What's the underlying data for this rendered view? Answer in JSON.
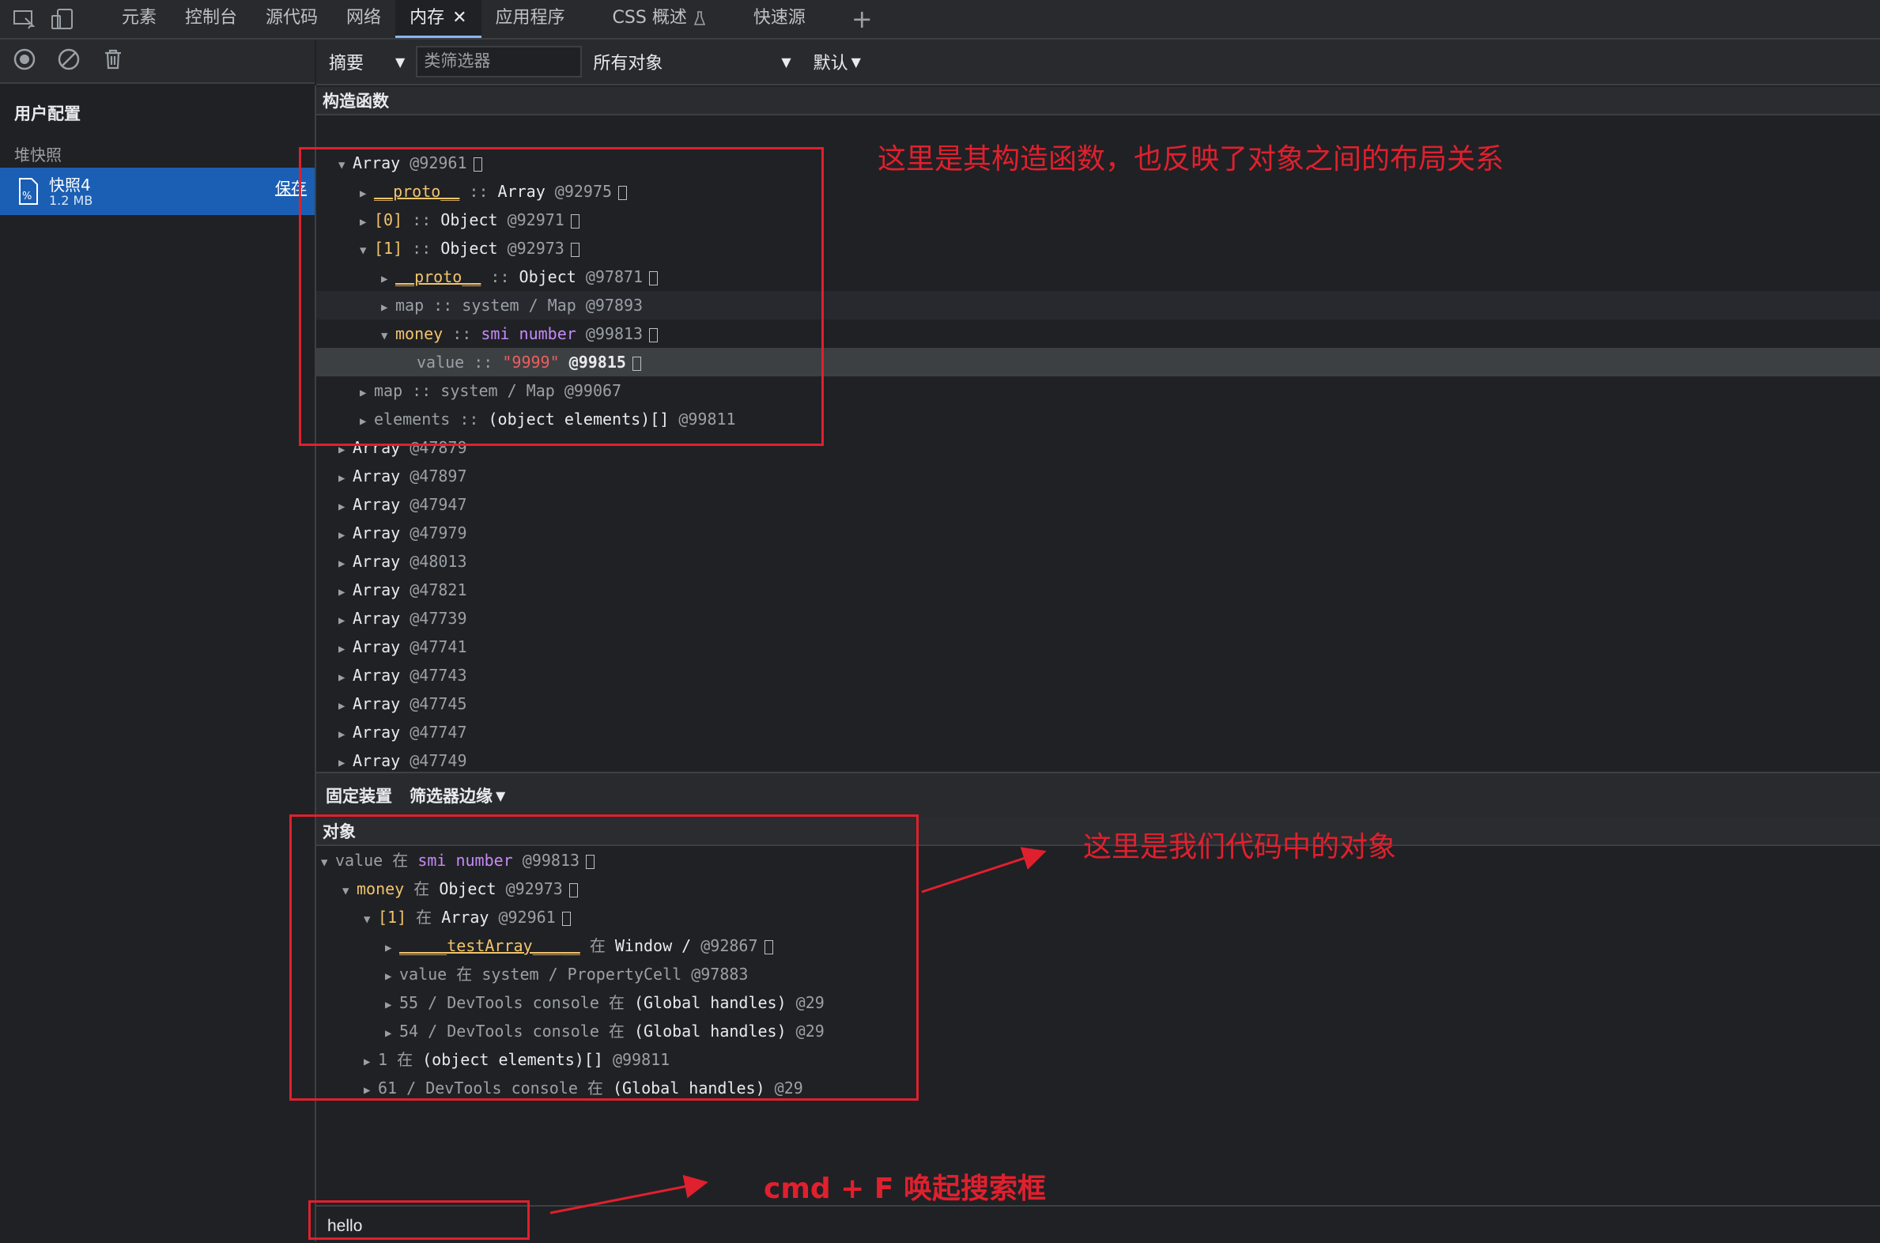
{
  "tabs": {
    "items": [
      "元素",
      "控制台",
      "源代码",
      "网络",
      "内存",
      "应用程序",
      "CSS 概述",
      "快速源"
    ],
    "active_index": 4,
    "close_glyph": "✕",
    "add_glyph": "+"
  },
  "sidebar": {
    "profiles_title": "用户配置",
    "heap_title": "堆快照",
    "snapshot_name": "快照4",
    "snapshot_size": "1.2 MB",
    "save_label": "保存"
  },
  "toolbar": {
    "view_select": "摘要",
    "class_filter_placeholder": "类筛选器",
    "objects_select": "所有对象",
    "default_select": "默认"
  },
  "constructor_header": "构造函数",
  "retainers_bar": {
    "fixtures_label": "固定装置",
    "filter_edges_label": "筛选器边缘"
  },
  "object_header": "对象",
  "constructor_tree": [
    {
      "indent": 0,
      "arrow": "down",
      "parts": [
        {
          "t": "Array",
          "c": "k"
        },
        {
          "t": " @92961",
          "c": "dim"
        }
      ],
      "box": true
    },
    {
      "indent": 1,
      "arrow": "right",
      "parts": [
        {
          "t": "__proto__",
          "c": "kp u"
        },
        {
          "t": " :: ",
          "c": "sep"
        },
        {
          "t": "Array",
          "c": "k"
        },
        {
          "t": " @92975",
          "c": "dim"
        }
      ],
      "box": true
    },
    {
      "indent": 1,
      "arrow": "right",
      "parts": [
        {
          "t": "[0]",
          "c": "kp"
        },
        {
          "t": " :: ",
          "c": "sep"
        },
        {
          "t": "Object",
          "c": "k"
        },
        {
          "t": " @92971",
          "c": "dim"
        }
      ],
      "box": true
    },
    {
      "indent": 1,
      "arrow": "down",
      "parts": [
        {
          "t": "[1]",
          "c": "kp"
        },
        {
          "t": " :: ",
          "c": "sep"
        },
        {
          "t": "Object",
          "c": "k"
        },
        {
          "t": " @92973",
          "c": "dim"
        }
      ],
      "box": true
    },
    {
      "indent": 2,
      "arrow": "right",
      "parts": [
        {
          "t": "__proto__",
          "c": "kp u"
        },
        {
          "t": " :: ",
          "c": "sep"
        },
        {
          "t": "Object",
          "c": "k"
        },
        {
          "t": " @97871",
          "c": "dim"
        }
      ],
      "box": true
    },
    {
      "indent": 2,
      "arrow": "right",
      "hl": "hl2",
      "parts": [
        {
          "t": "map",
          "c": "dim"
        },
        {
          "t": " :: ",
          "c": "sep"
        },
        {
          "t": "system / Map",
          "c": "dim"
        },
        {
          "t": " @97893",
          "c": "dim"
        }
      ],
      "box": false
    },
    {
      "indent": 2,
      "arrow": "down",
      "parts": [
        {
          "t": "money",
          "c": "kp"
        },
        {
          "t": " :: ",
          "c": "sep"
        },
        {
          "t": "smi number",
          "c": "kpurple"
        },
        {
          "t": " @99813",
          "c": "dim"
        }
      ],
      "box": true
    },
    {
      "indent": 3,
      "arrow": "none",
      "hl": "hl",
      "parts": [
        {
          "t": "value",
          "c": "dim"
        },
        {
          "t": " :: ",
          "c": "sep"
        },
        {
          "t": "\"9999\"",
          "c": "str"
        },
        {
          "t": " @99815",
          "c": "kb"
        }
      ],
      "box": true
    },
    {
      "indent": 1,
      "arrow": "right",
      "parts": [
        {
          "t": "map",
          "c": "dim"
        },
        {
          "t": " :: ",
          "c": "sep"
        },
        {
          "t": "system / Map",
          "c": "dim"
        },
        {
          "t": " @99067",
          "c": "dim"
        }
      ],
      "box": false
    },
    {
      "indent": 1,
      "arrow": "right",
      "parts": [
        {
          "t": "elements",
          "c": "dim"
        },
        {
          "t": " :: ",
          "c": "sep"
        },
        {
          "t": "(object elements)[]",
          "c": "k"
        },
        {
          "t": " @99811",
          "c": "dim"
        }
      ],
      "box": false
    },
    {
      "indent": 0,
      "arrow": "right",
      "parts": [
        {
          "t": "Array",
          "c": "k"
        },
        {
          "t": " @47879",
          "c": "dim"
        }
      ],
      "box": false
    },
    {
      "indent": 0,
      "arrow": "right",
      "parts": [
        {
          "t": "Array",
          "c": "k"
        },
        {
          "t": " @47897",
          "c": "dim"
        }
      ],
      "box": false
    },
    {
      "indent": 0,
      "arrow": "right",
      "parts": [
        {
          "t": "Array",
          "c": "k"
        },
        {
          "t": " @47947",
          "c": "dim"
        }
      ],
      "box": false
    },
    {
      "indent": 0,
      "arrow": "right",
      "parts": [
        {
          "t": "Array",
          "c": "k"
        },
        {
          "t": " @47979",
          "c": "dim"
        }
      ],
      "box": false
    },
    {
      "indent": 0,
      "arrow": "right",
      "parts": [
        {
          "t": "Array",
          "c": "k"
        },
        {
          "t": " @48013",
          "c": "dim"
        }
      ],
      "box": false
    },
    {
      "indent": 0,
      "arrow": "right",
      "parts": [
        {
          "t": "Array",
          "c": "k"
        },
        {
          "t": " @47821",
          "c": "dim"
        }
      ],
      "box": false
    },
    {
      "indent": 0,
      "arrow": "right",
      "parts": [
        {
          "t": "Array",
          "c": "k"
        },
        {
          "t": " @47739",
          "c": "dim"
        }
      ],
      "box": false
    },
    {
      "indent": 0,
      "arrow": "right",
      "parts": [
        {
          "t": "Array",
          "c": "k"
        },
        {
          "t": " @47741",
          "c": "dim"
        }
      ],
      "box": false
    },
    {
      "indent": 0,
      "arrow": "right",
      "parts": [
        {
          "t": "Array",
          "c": "k"
        },
        {
          "t": " @47743",
          "c": "dim"
        }
      ],
      "box": false
    },
    {
      "indent": 0,
      "arrow": "right",
      "parts": [
        {
          "t": "Array",
          "c": "k"
        },
        {
          "t": " @47745",
          "c": "dim"
        }
      ],
      "box": false
    },
    {
      "indent": 0,
      "arrow": "right",
      "parts": [
        {
          "t": "Array",
          "c": "k"
        },
        {
          "t": " @47747",
          "c": "dim"
        }
      ],
      "box": false
    },
    {
      "indent": 0,
      "arrow": "right",
      "parts": [
        {
          "t": "Array",
          "c": "k"
        },
        {
          "t": " @47749",
          "c": "dim"
        }
      ],
      "box": false
    }
  ],
  "retainer_tree": [
    {
      "indent": 0,
      "arrow": "down",
      "parts": [
        {
          "t": "value",
          "c": "dim"
        },
        {
          "t": " 在 ",
          "c": "dim"
        },
        {
          "t": "smi number",
          "c": "kpurple"
        },
        {
          "t": " @99813",
          "c": "dim"
        }
      ],
      "box": true
    },
    {
      "indent": 1,
      "arrow": "down",
      "parts": [
        {
          "t": "money",
          "c": "kp"
        },
        {
          "t": " 在 ",
          "c": "dim"
        },
        {
          "t": "Object",
          "c": "k"
        },
        {
          "t": " @92973",
          "c": "dim"
        }
      ],
      "box": true
    },
    {
      "indent": 2,
      "arrow": "down",
      "parts": [
        {
          "t": "[1]",
          "c": "kp"
        },
        {
          "t": " 在 ",
          "c": "dim"
        },
        {
          "t": "Array",
          "c": "k"
        },
        {
          "t": " @92961",
          "c": "dim"
        }
      ],
      "box": true
    },
    {
      "indent": 3,
      "arrow": "right",
      "parts": [
        {
          "t": "_____testArray_____",
          "c": "kp u"
        },
        {
          "t": " 在 ",
          "c": "dim"
        },
        {
          "t": "Window /",
          "c": "k"
        },
        {
          "t": "  @92867",
          "c": "dim"
        }
      ],
      "box": true
    },
    {
      "indent": 3,
      "arrow": "right",
      "parts": [
        {
          "t": "value",
          "c": "dim"
        },
        {
          "t": " 在 ",
          "c": "dim"
        },
        {
          "t": "system / PropertyCell",
          "c": "dim"
        },
        {
          "t": " @97883",
          "c": "dim"
        }
      ],
      "box": false
    },
    {
      "indent": 3,
      "arrow": "right",
      "parts": [
        {
          "t": "55 / DevTools console",
          "c": "dim"
        },
        {
          "t": " 在 ",
          "c": "dim"
        },
        {
          "t": "(Global handles)",
          "c": "k"
        },
        {
          "t": " @29",
          "c": "dim"
        }
      ],
      "box": false
    },
    {
      "indent": 3,
      "arrow": "right",
      "parts": [
        {
          "t": "54 / DevTools console",
          "c": "dim"
        },
        {
          "t": " 在 ",
          "c": "dim"
        },
        {
          "t": "(Global handles)",
          "c": "k"
        },
        {
          "t": " @29",
          "c": "dim"
        }
      ],
      "box": false
    },
    {
      "indent": 2,
      "arrow": "right",
      "parts": [
        {
          "t": "1",
          "c": "dim"
        },
        {
          "t": " 在 ",
          "c": "dim"
        },
        {
          "t": "(object elements)[]",
          "c": "k"
        },
        {
          "t": " @99811",
          "c": "dim"
        }
      ],
      "box": false
    },
    {
      "indent": 2,
      "arrow": "right",
      "parts": [
        {
          "t": "61 / DevTools console",
          "c": "dim"
        },
        {
          "t": " 在 ",
          "c": "dim"
        },
        {
          "t": "(Global handles)",
          "c": "k"
        },
        {
          "t": " @29",
          "c": "dim"
        }
      ],
      "box": false
    }
  ],
  "search_value": "hello",
  "annotations": {
    "constructor_note": "这里是其构造函数，也反映了对象之间的布局关系",
    "object_note": "这里是我们代码中的对象",
    "search_note": "cmd + F 唤起搜索框",
    "color": "#e0202e"
  }
}
